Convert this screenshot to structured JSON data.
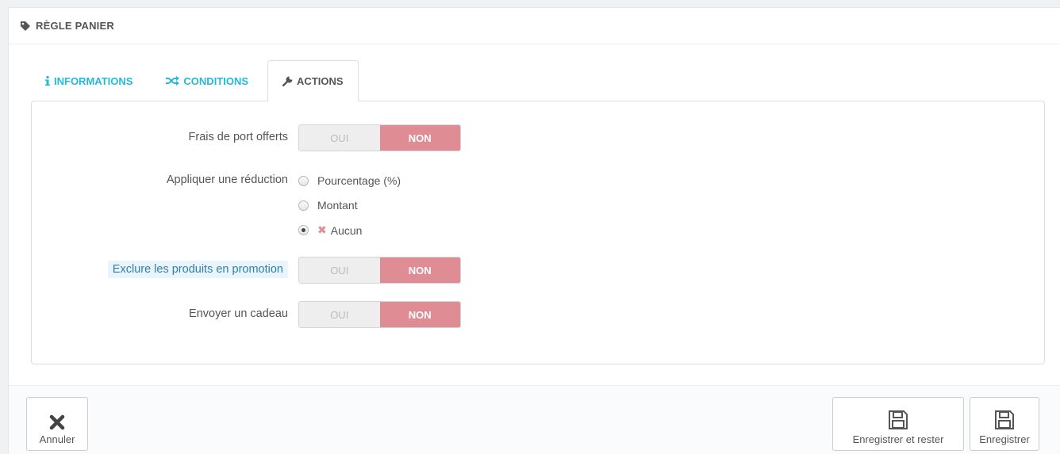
{
  "panel": {
    "title": "RÈGLE PANIER",
    "icon": "tag-icon"
  },
  "tabs": [
    {
      "label": "INFORMATIONS",
      "icon": "info-icon",
      "active": false
    },
    {
      "label": "CONDITIONS",
      "icon": "shuffle-icon",
      "active": false
    },
    {
      "label": "ACTIONS",
      "icon": "wrench-icon",
      "active": true
    }
  ],
  "form": {
    "free_shipping": {
      "label": "Frais de port offerts",
      "yes": "OUI",
      "no": "NON",
      "value": "NON"
    },
    "apply_discount": {
      "label": "Appliquer une réduction",
      "options": [
        "Pourcentage (%)",
        "Montant",
        "Aucun"
      ],
      "selected": "Aucun"
    },
    "exclude_promo": {
      "label": "Exclure les produits en promotion",
      "yes": "OUI",
      "no": "NON",
      "value": "NON"
    },
    "send_gift": {
      "label": "Envoyer un cadeau",
      "yes": "OUI",
      "no": "NON",
      "value": "NON"
    }
  },
  "footer": {
    "cancel": "Annuler",
    "save_stay": "Enregistrer et rester",
    "save": "Enregistrer"
  },
  "colors": {
    "accent": "#25b9d7",
    "no_active": "#e08c95"
  }
}
